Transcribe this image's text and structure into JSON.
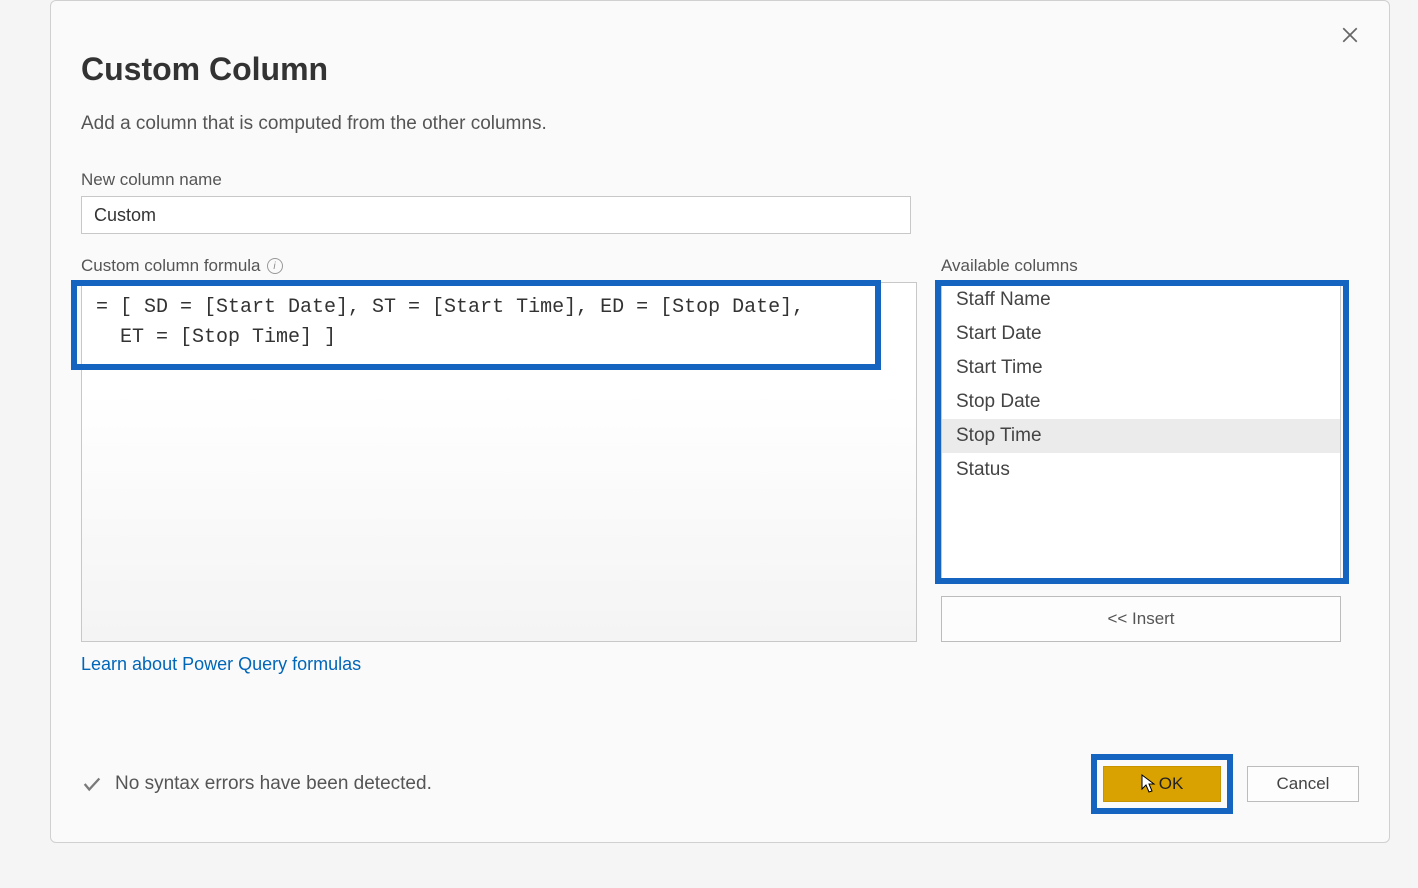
{
  "dialog": {
    "title": "Custom Column",
    "subtitle": "Add a column that is computed from the other columns.",
    "close_tooltip": "Close"
  },
  "new_column": {
    "label": "New column name",
    "value": "Custom"
  },
  "formula": {
    "label": "Custom column formula",
    "value": "= [ SD = [Start Date], ST = [Start Time], ED = [Stop Date],\n  ET = [Stop Time] ]"
  },
  "available_columns": {
    "label": "Available columns",
    "items": [
      {
        "name": "Staff Name",
        "selected": false
      },
      {
        "name": "Start Date",
        "selected": false
      },
      {
        "name": "Start Time",
        "selected": false
      },
      {
        "name": "Stop Date",
        "selected": false
      },
      {
        "name": "Stop Time",
        "selected": true
      },
      {
        "name": "Status",
        "selected": false
      }
    ],
    "insert_label": "<< Insert"
  },
  "link": {
    "text": "Learn about Power Query formulas"
  },
  "status": {
    "message": "No syntax errors have been detected."
  },
  "buttons": {
    "ok": "OK",
    "cancel": "Cancel"
  },
  "highlight_color": "#1565c0"
}
